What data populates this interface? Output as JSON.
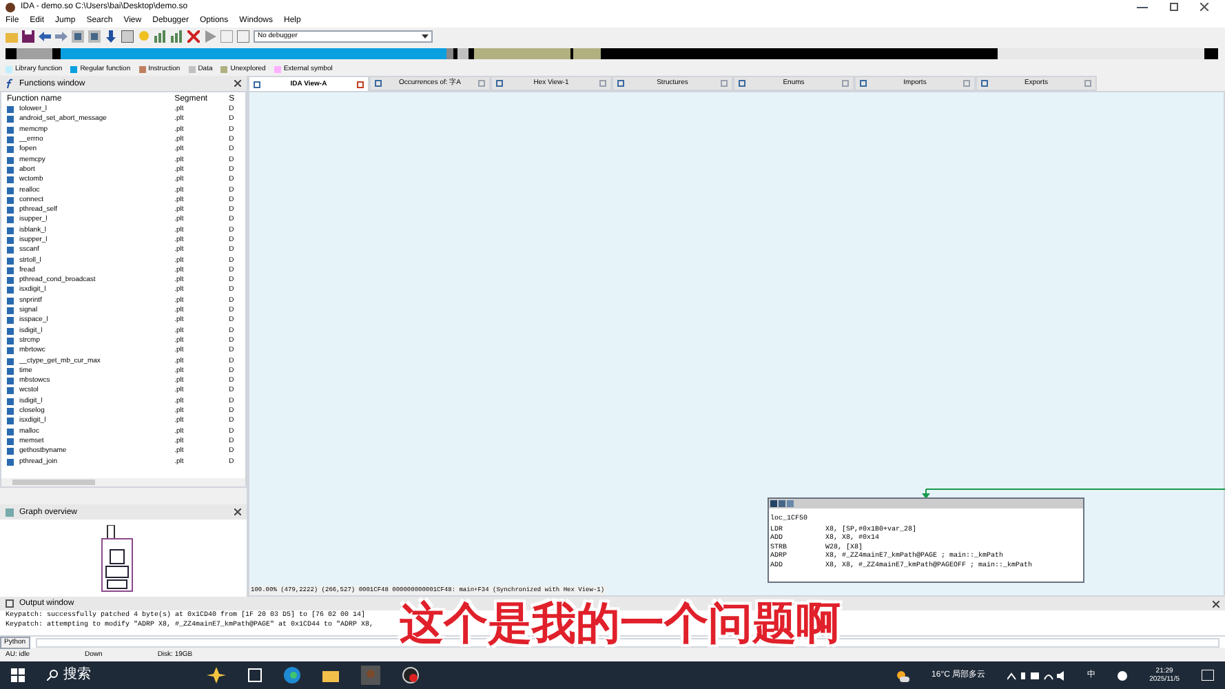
{
  "window": {
    "title": "IDA - demo.so C:\\Users\\bai\\Desktop\\demo.so"
  },
  "menu": [
    "File",
    "Edit",
    "Jump",
    "Search",
    "View",
    "Debugger",
    "Options",
    "Windows",
    "Help"
  ],
  "debugger": {
    "value": "No debugger"
  },
  "legend": [
    {
      "label": "Library function",
      "color": "#c0f0ff"
    },
    {
      "label": "Regular function",
      "color": "#0aa0e0"
    },
    {
      "label": "Instruction",
      "color": "#c08060"
    },
    {
      "label": "Data",
      "color": "#c0c0c0"
    },
    {
      "label": "Unexplored",
      "color": "#b0b080"
    },
    {
      "label": "External symbol",
      "color": "#ffb0ff"
    }
  ],
  "functions_window": {
    "title": "Functions window",
    "columns": [
      "Function name",
      "Segment",
      "S"
    ],
    "rows": [
      {
        "name": "tolower_l",
        "segment": ".plt",
        "column_3": "D"
      },
      {
        "name": "android_set_abort_message",
        "segment": ".plt",
        "column_3": "D"
      },
      {
        "name": "memcmp",
        "segment": ".plt",
        "column_3": "D"
      },
      {
        "name": "__errno",
        "segment": ".plt",
        "column_3": "D"
      },
      {
        "name": "fopen",
        "segment": ".plt",
        "column_3": "D"
      },
      {
        "name": "memcpy",
        "segment": ".plt",
        "column_3": "D"
      },
      {
        "name": "abort",
        "segment": ".plt",
        "column_3": "D"
      },
      {
        "name": "wctomb",
        "segment": ".plt",
        "column_3": "D"
      },
      {
        "name": "realloc",
        "segment": ".plt",
        "column_3": "D"
      },
      {
        "name": "connect",
        "segment": ".plt",
        "column_3": "D"
      },
      {
        "name": "pthread_self",
        "segment": ".plt",
        "column_3": "D"
      },
      {
        "name": "isupper_l",
        "segment": ".plt",
        "column_3": "D"
      },
      {
        "name": "isblank_l",
        "segment": ".plt",
        "column_3": "D"
      },
      {
        "name": "isupper_l",
        "segment": ".plt",
        "column_3": "D"
      },
      {
        "name": "sscanf",
        "segment": ".plt",
        "column_3": "D"
      },
      {
        "name": "strtoll_l",
        "segment": ".plt",
        "column_3": "D"
      },
      {
        "name": "fread",
        "segment": ".plt",
        "column_3": "D"
      },
      {
        "name": "pthread_cond_broadcast",
        "segment": ".plt",
        "column_3": "D"
      },
      {
        "name": "isxdigit_l",
        "segment": ".plt",
        "column_3": "D"
      },
      {
        "name": "snprintf",
        "segment": ".plt",
        "column_3": "D"
      },
      {
        "name": "signal",
        "segment": ".plt",
        "column_3": "D"
      },
      {
        "name": "isspace_l",
        "segment": ".plt",
        "column_3": "D"
      },
      {
        "name": "isdigit_l",
        "segment": ".plt",
        "column_3": "D"
      },
      {
        "name": "strcmp",
        "segment": ".plt",
        "column_3": "D"
      },
      {
        "name": "mbrtowc",
        "segment": ".plt",
        "column_3": "D"
      },
      {
        "name": "__ctype_get_mb_cur_max",
        "segment": ".plt",
        "column_3": "D"
      },
      {
        "name": "time",
        "segment": ".plt",
        "column_3": "D"
      },
      {
        "name": "mbstowcs",
        "segment": ".plt",
        "column_3": "D"
      },
      {
        "name": "wcstol",
        "segment": ".plt",
        "column_3": "D"
      },
      {
        "name": "isdigit_l",
        "segment": ".plt",
        "column_3": "D"
      },
      {
        "name": "closelog",
        "segment": ".plt",
        "column_3": "D"
      },
      {
        "name": "isxdigit_l",
        "segment": ".plt",
        "column_3": "D"
      },
      {
        "name": "malloc",
        "segment": ".plt",
        "column_3": "D"
      },
      {
        "name": "memset",
        "segment": ".plt",
        "column_3": "D"
      },
      {
        "name": "gethostbyname",
        "segment": ".plt",
        "column_3": "D"
      },
      {
        "name": "pthread_join",
        "segment": ".plt",
        "column_3": "D"
      }
    ]
  },
  "graph_overview": {
    "title": "Graph overview"
  },
  "tabs": [
    {
      "label": "IDA View-A",
      "selected": true
    },
    {
      "label": "Occurrences of: 字A",
      "selected": false
    },
    {
      "label": "Hex View-1",
      "selected": false
    },
    {
      "label": "Structures",
      "selected": false
    },
    {
      "label": "Enums",
      "selected": false
    },
    {
      "label": "Imports",
      "selected": false
    },
    {
      "label": "Exports",
      "selected": false
    }
  ],
  "code_block": {
    "label": "loc_1CF50",
    "lines": [
      {
        "mnemonic": "LDR",
        "operands": "X8, [SP,#0x1B0+var_28]"
      },
      {
        "mnemonic": "ADD",
        "operands": "X8, X8, #0x14"
      },
      {
        "mnemonic": "STRB",
        "operands": "W28, [X8]"
      },
      {
        "mnemonic": "ADRP",
        "operands": "X8, #_ZZ4mainE7_kmPath@PAGE ; main::_kmPath"
      },
      {
        "mnemonic": "ADD",
        "operands": "X8, X8, #_ZZ4mainE7_kmPath@PAGEOFF ; main::_kmPath"
      }
    ]
  },
  "view_status": "100.00% (479,2222) (266,527) 0001CF48 000000000001CF48: main+F34 (Synchronized with Hex View-1)",
  "output_window": {
    "title": "Output window",
    "lines": [
      "Keypatch: successfully patched 4 byte(s) at 0x1CD40 from [1F 20 03 D5] to [76 02 00 14]",
      "Keypatch: attempting to modify \"ADRP X8, #_ZZ4mainE7_kmPath@PAGE\" at 0x1CD44 to \"ADRP X8,"
    ],
    "input_label": "Python"
  },
  "status_bar": [
    "AU:  idle",
    "Down",
    "Disk: 19GB"
  ],
  "subtitle": "这个是我的一个问题啊",
  "taskbar": {
    "search": "搜索",
    "weather": "16°C 局部多云",
    "ime": "中",
    "time": "21:29",
    "date": "2025/11/5"
  }
}
